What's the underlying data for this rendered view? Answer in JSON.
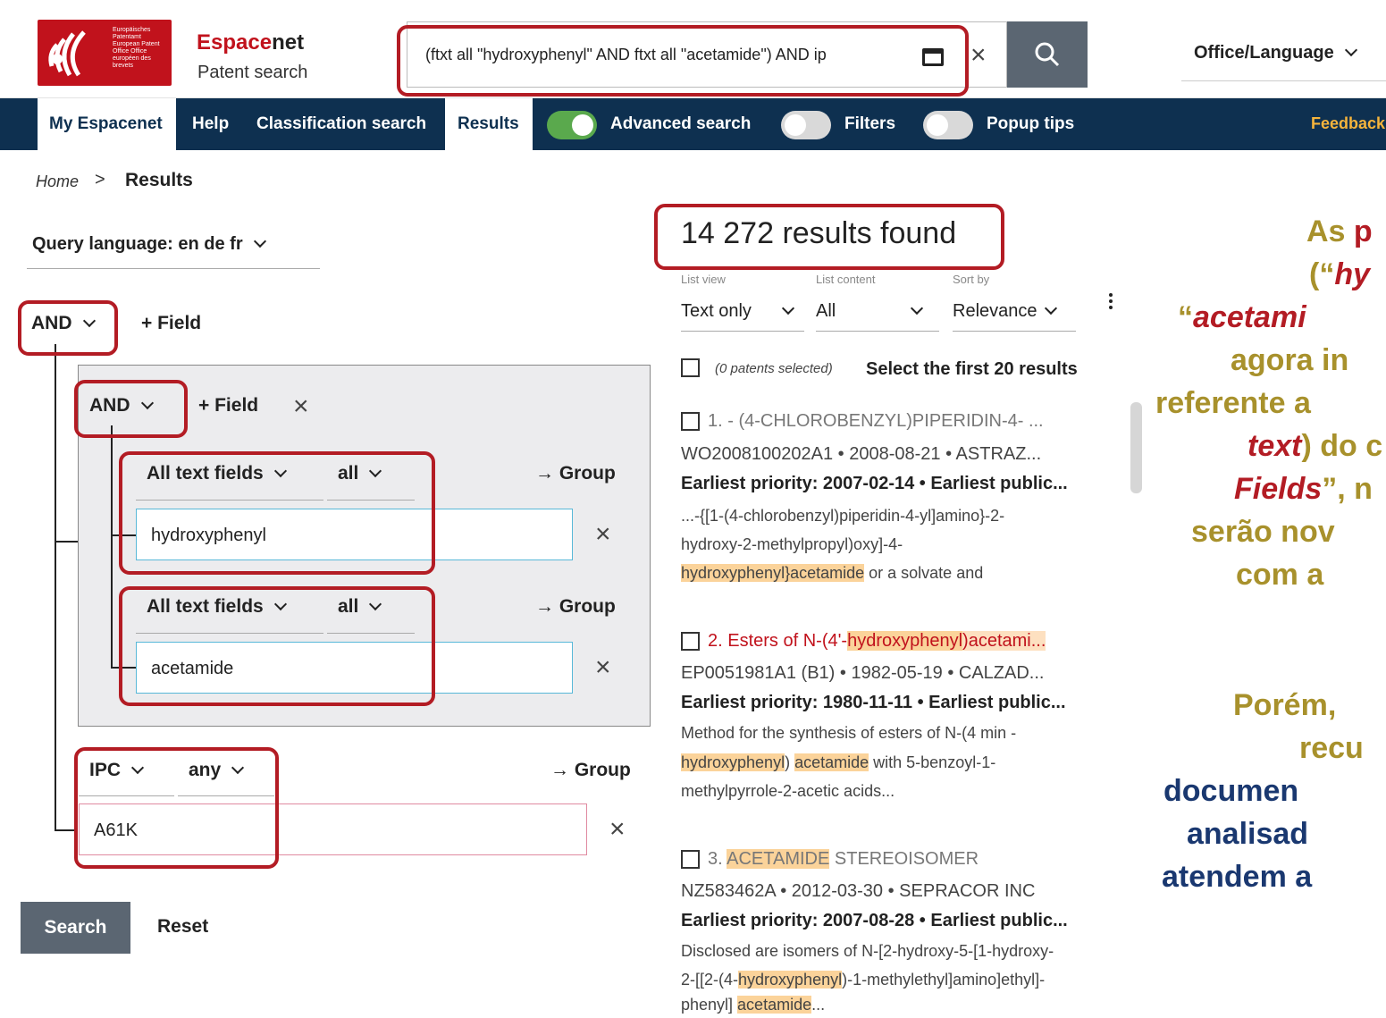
{
  "header": {
    "logo_text": "Europäisches Patentamt European Patent Office Office européen des brevets",
    "brand_espace": "Espace",
    "brand_net": "net",
    "brand_sub": "Patent search",
    "search_value": "(ftxt all \"hydroxyphenyl\" AND ftxt all \"acetamide\") AND ip",
    "office_language": "Office/Language"
  },
  "nav": {
    "my_espacenet": "My Espacenet",
    "help": "Help",
    "classification": "Classification search",
    "results": "Results",
    "advanced": "Advanced search",
    "filters": "Filters",
    "popup": "Popup tips",
    "feedback": "Feedback",
    "toggles": {
      "advanced": true,
      "filters": false,
      "popup": false
    }
  },
  "breadcrumb": {
    "home": "Home",
    "sep": ">",
    "current": "Results"
  },
  "query": {
    "language": "Query language: en de fr",
    "root_op": "AND",
    "add_field": "+ Field",
    "group_op": "AND",
    "group_add_field": "+ Field",
    "field1": {
      "field": "All text fields",
      "mode": "all",
      "value": "hydroxyphenyl",
      "group": "→ Group"
    },
    "field2": {
      "field": "All text fields",
      "mode": "all",
      "value": "acetamide",
      "group": "→ Group"
    },
    "field3": {
      "field": "IPC",
      "mode": "any",
      "value": "A61K",
      "group": "→ Group"
    },
    "search_button": "Search",
    "reset_button": "Reset"
  },
  "results": {
    "count": "14 272 results found",
    "list_view_label": "List view",
    "list_view_value": "Text only",
    "list_content_label": "List content",
    "list_content_value": "All",
    "sort_label": "Sort by",
    "sort_value": "Relevance",
    "selected_note": "(0 patents selected)",
    "select_first": "Select the first 20 results",
    "items": [
      {
        "title": "1. - (4-CHLOROBENZYL)PIPERIDIN-4- ...",
        "meta": "WO2008100202A1 • 2008-08-21 • ASTRAZ...",
        "prio": "Earliest priority: 2007-02-14 • Earliest public...",
        "snip1": "...-{[1-(4-chlorobenzyl)piperidin-4-yl]amino}-2-",
        "snip2": "hydroxy-2-methylpropyl)oxy]-4-",
        "snip3a": "hydroxyphenyl}acetamide",
        "snip3b": " or a solvate and"
      },
      {
        "title_a": "2. Esters of N-(4'-",
        "title_b": "hydroxyphenyl",
        "title_c": ")acetami...",
        "meta": "EP0051981A1 (B1) • 1982-05-19 • CALZAD...",
        "prio": "Earliest priority: 1980-11-11 • Earliest public...",
        "snip1": "Method for the synthesis of esters of N-(4 min -",
        "snip2a": "hydroxyphenyl",
        "snip2b": ") ",
        "snip2c": "acetamide",
        "snip2d": " with 5-benzoyl-1-",
        "snip3": "methylpyrrole-2-acetic acids..."
      },
      {
        "title_a": "3. ",
        "title_b": "ACETAMIDE",
        "title_c": " STEREOISOMER",
        "meta": "NZ583462A • 2012-03-30 • SEPRACOR INC",
        "prio": "Earliest priority: 2007-08-28 • Earliest public...",
        "snip1": "Disclosed are isomers of N-[2-hydroxy-5-[1-hydroxy-",
        "snip2a": "2-[[2-(4-",
        "snip2b": "hydroxyphenyl",
        "snip2c": ")-1-methylethyl]amino]ethyl]-",
        "snip3a": "phenyl] ",
        "snip3b": "acetamide",
        "snip3c": "..."
      }
    ]
  },
  "annotation": {
    "l1a": "As ",
    "l1b": "p",
    "l2a": "(“",
    "l2b": "hy",
    "l3a": "“",
    "l3b": "acetami",
    "l4": "agora in",
    "l5": "referente a",
    "l6a": "text",
    "l6b": ") do c",
    "l7a": "Fields",
    "l7b": "”, n",
    "l8": "serão nov",
    "l9": "com a",
    "l10": "Porém,",
    "l11": "recu",
    "l12": "documen",
    "l13": "analisad",
    "l14": "atendem a"
  }
}
